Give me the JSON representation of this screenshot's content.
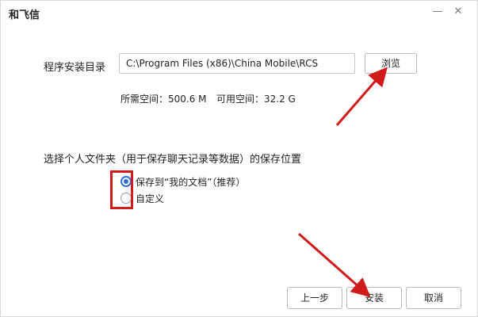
{
  "window": {
    "title": "和飞信",
    "minimize_glyph": "—",
    "close_glyph": "✕"
  },
  "install_dir": {
    "label": "程序安装目录",
    "path": "C:\\Program Files (x86)\\China Mobile\\RCS",
    "browse_label": "浏览",
    "required_space": "所需空间：500.6 M",
    "available_space": "可用空间：32.2 G"
  },
  "personal_folder": {
    "label": "选择个人文件夹（用于保存聊天记录等数据）的保存位置",
    "options": [
      {
        "label": "保存到“我的文档”（推荐）",
        "selected": true
      },
      {
        "label": "自定义",
        "selected": false
      }
    ]
  },
  "footer": {
    "prev_label": "上一步",
    "install_label": "安装",
    "cancel_label": "取消"
  },
  "colors": {
    "accent": "#2f6fe0",
    "annotation_red": "#d11a1a"
  }
}
